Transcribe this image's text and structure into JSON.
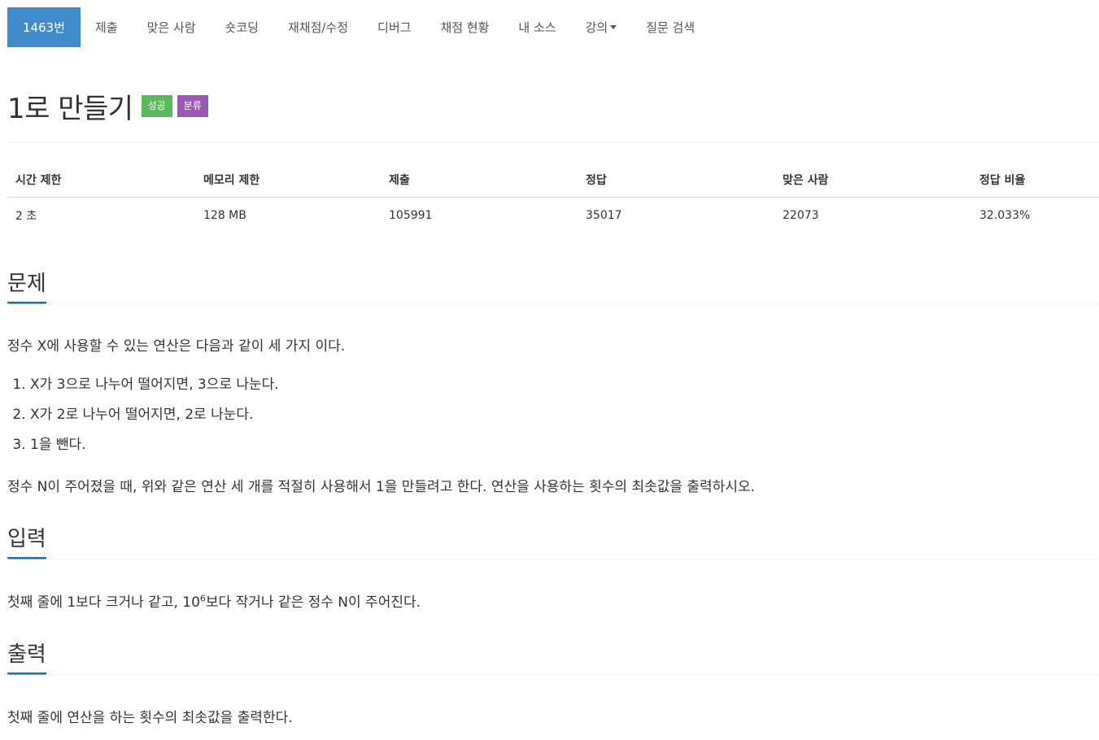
{
  "nav": {
    "items": [
      {
        "label": "1463번",
        "active": true
      },
      {
        "label": "제출"
      },
      {
        "label": "맞은 사람"
      },
      {
        "label": "숏코딩"
      },
      {
        "label": "재채점/수정"
      },
      {
        "label": "디버그"
      },
      {
        "label": "채점 현황"
      },
      {
        "label": "내 소스"
      },
      {
        "label": "강의",
        "dropdown": true
      },
      {
        "label": "질문 검색"
      }
    ]
  },
  "problem": {
    "title": "1로 만들기",
    "badges": {
      "success": "성공",
      "tag": "분류"
    }
  },
  "colors": {
    "nav_active": "#428bca",
    "success": "#5cb85c",
    "tag": "#9b59b6",
    "section_underline": "#0e76b8"
  },
  "info_table": {
    "headers": [
      "시간 제한",
      "메모리 제한",
      "제출",
      "정답",
      "맞은 사람",
      "정답 비율"
    ],
    "values": [
      "2 초",
      "128 MB",
      "105991",
      "35017",
      "22073",
      "32.033%"
    ]
  },
  "sections": {
    "description": {
      "title": "문제",
      "intro": "정수 X에 사용할 수 있는 연산은 다음과 같이 세 가지 이다.",
      "steps": [
        "X가 3으로 나누어 떨어지면, 3으로 나눈다.",
        "X가 2로 나누어 떨어지면, 2로 나눈다.",
        "1을 뺀다."
      ],
      "outro": "정수 N이 주어졌을 때, 위와 같은 연산 세 개를 적절히 사용해서 1을 만들려고 한다. 연산을 사용하는 횟수의 최솟값을 출력하시오."
    },
    "input": {
      "title": "입력",
      "text_before": "첫째 줄에 1보다 크거나 같고, 10",
      "sup": "6",
      "text_after": "보다 작거나 같은 정수 N이 주어진다."
    },
    "output": {
      "title": "출력",
      "text": "첫째 줄에 연산을 하는 횟수의 최솟값을 출력한다."
    }
  }
}
